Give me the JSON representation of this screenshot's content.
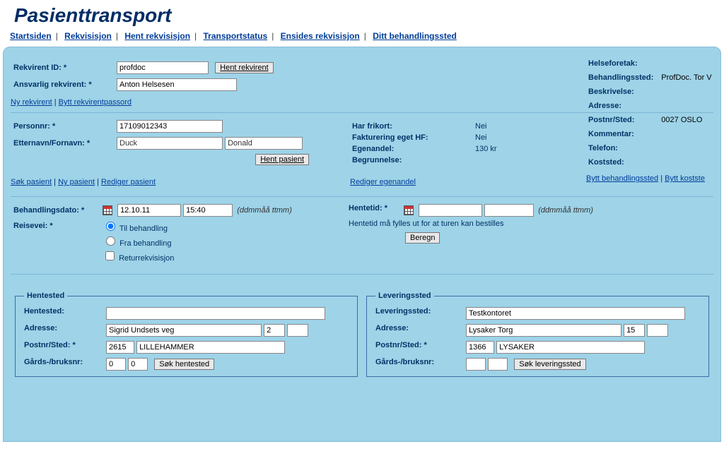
{
  "app": {
    "title": "Pasienttransport"
  },
  "nav": {
    "items": [
      "Startsiden",
      "Rekvisisjon",
      "Hent rekvisisjon",
      "Transportstatus",
      "Ensides rekvisisjon",
      "Ditt behandlingssted"
    ]
  },
  "rekvirent": {
    "id_label": "Rekvirent ID: *",
    "id_value": "profdoc",
    "hent_btn": "Hent rekvirent",
    "ansvarlig_label": "Ansvarlig rekvirent: *",
    "ansvarlig_value": "Anton Helsesen",
    "links": {
      "ny": "Ny rekvirent",
      "byttpw": "Bytt rekvirentpassord"
    }
  },
  "info": {
    "helseforetak": "Helseforetak:",
    "beh_sted_label": "Behandlingssted:",
    "beh_sted_value": "ProfDoc. Tor V",
    "beskrivelse": "Beskrivelse:",
    "adresse": "Adresse:",
    "postnr_label": "Postnr/Sted:",
    "postnr_value": "0027 OSLO",
    "kommentar": "Kommentar:",
    "telefon": "Telefon:",
    "koststed": "Koststed:",
    "links": {
      "bytt_beh": "Bytt behandlingssted",
      "bytt_kost": "Bytt kostste"
    }
  },
  "pasient": {
    "personnr_label": "Personnr: *",
    "personnr_value": "17109012343",
    "navn_label": "Etternavn/Fornavn: *",
    "etternavn": "Duck",
    "fornavn": "Donald",
    "hent_btn": "Hent pasient",
    "frikort_label": "Har frikort:",
    "frikort_val": "Nei",
    "fakt_label": "Fakturering eget HF:",
    "fakt_val": "Nei",
    "egenandel_label": "Egenandel:",
    "egenandel_val": "130 kr",
    "begr_label": "Begrunnelse:",
    "red_egen": "Rediger egenandel",
    "links": {
      "sok": "Søk pasient",
      "ny": "Ny pasient",
      "red": "Rediger pasient"
    }
  },
  "behandling": {
    "dato_label": "Behandlingsdato: *",
    "dato": "12.10.11",
    "tid": "15:40",
    "hint": "(ddmmåå ttmm)",
    "reise_label": "Reisevei: *",
    "r1": "Til behandling",
    "r2": "Fra behandling",
    "r3": "Returrekvisisjon",
    "hente_label": "Hentetid: *",
    "hente_hint": "Hentetid må fylles ut for at turen kan bestilles",
    "beregn": "Beregn"
  },
  "hentested": {
    "legend": "Hentested",
    "h_label": "Hentested:",
    "adr_label": "Adresse:",
    "adr": "Sigrid Undsets veg",
    "adr_nr": "2",
    "post_label": "Postnr/Sted: *",
    "postnr": "2615",
    "sted": "LILLEHAMMER",
    "gbnr_label": "Gårds-/bruksnr:",
    "g": "0",
    "b": "0",
    "sok_btn": "Søk hentested"
  },
  "lever": {
    "legend": "Leveringssted",
    "l_label": "Leveringssted:",
    "l_val": "Testkontoret",
    "adr_label": "Adresse:",
    "adr": "Lysaker Torg",
    "adr_nr": "15",
    "post_label": "Postnr/Sted: *",
    "postnr": "1366",
    "sted": "LYSAKER",
    "gbnr_label": "Gårds-/bruksnr:",
    "sok_btn": "Søk leveringssted"
  }
}
